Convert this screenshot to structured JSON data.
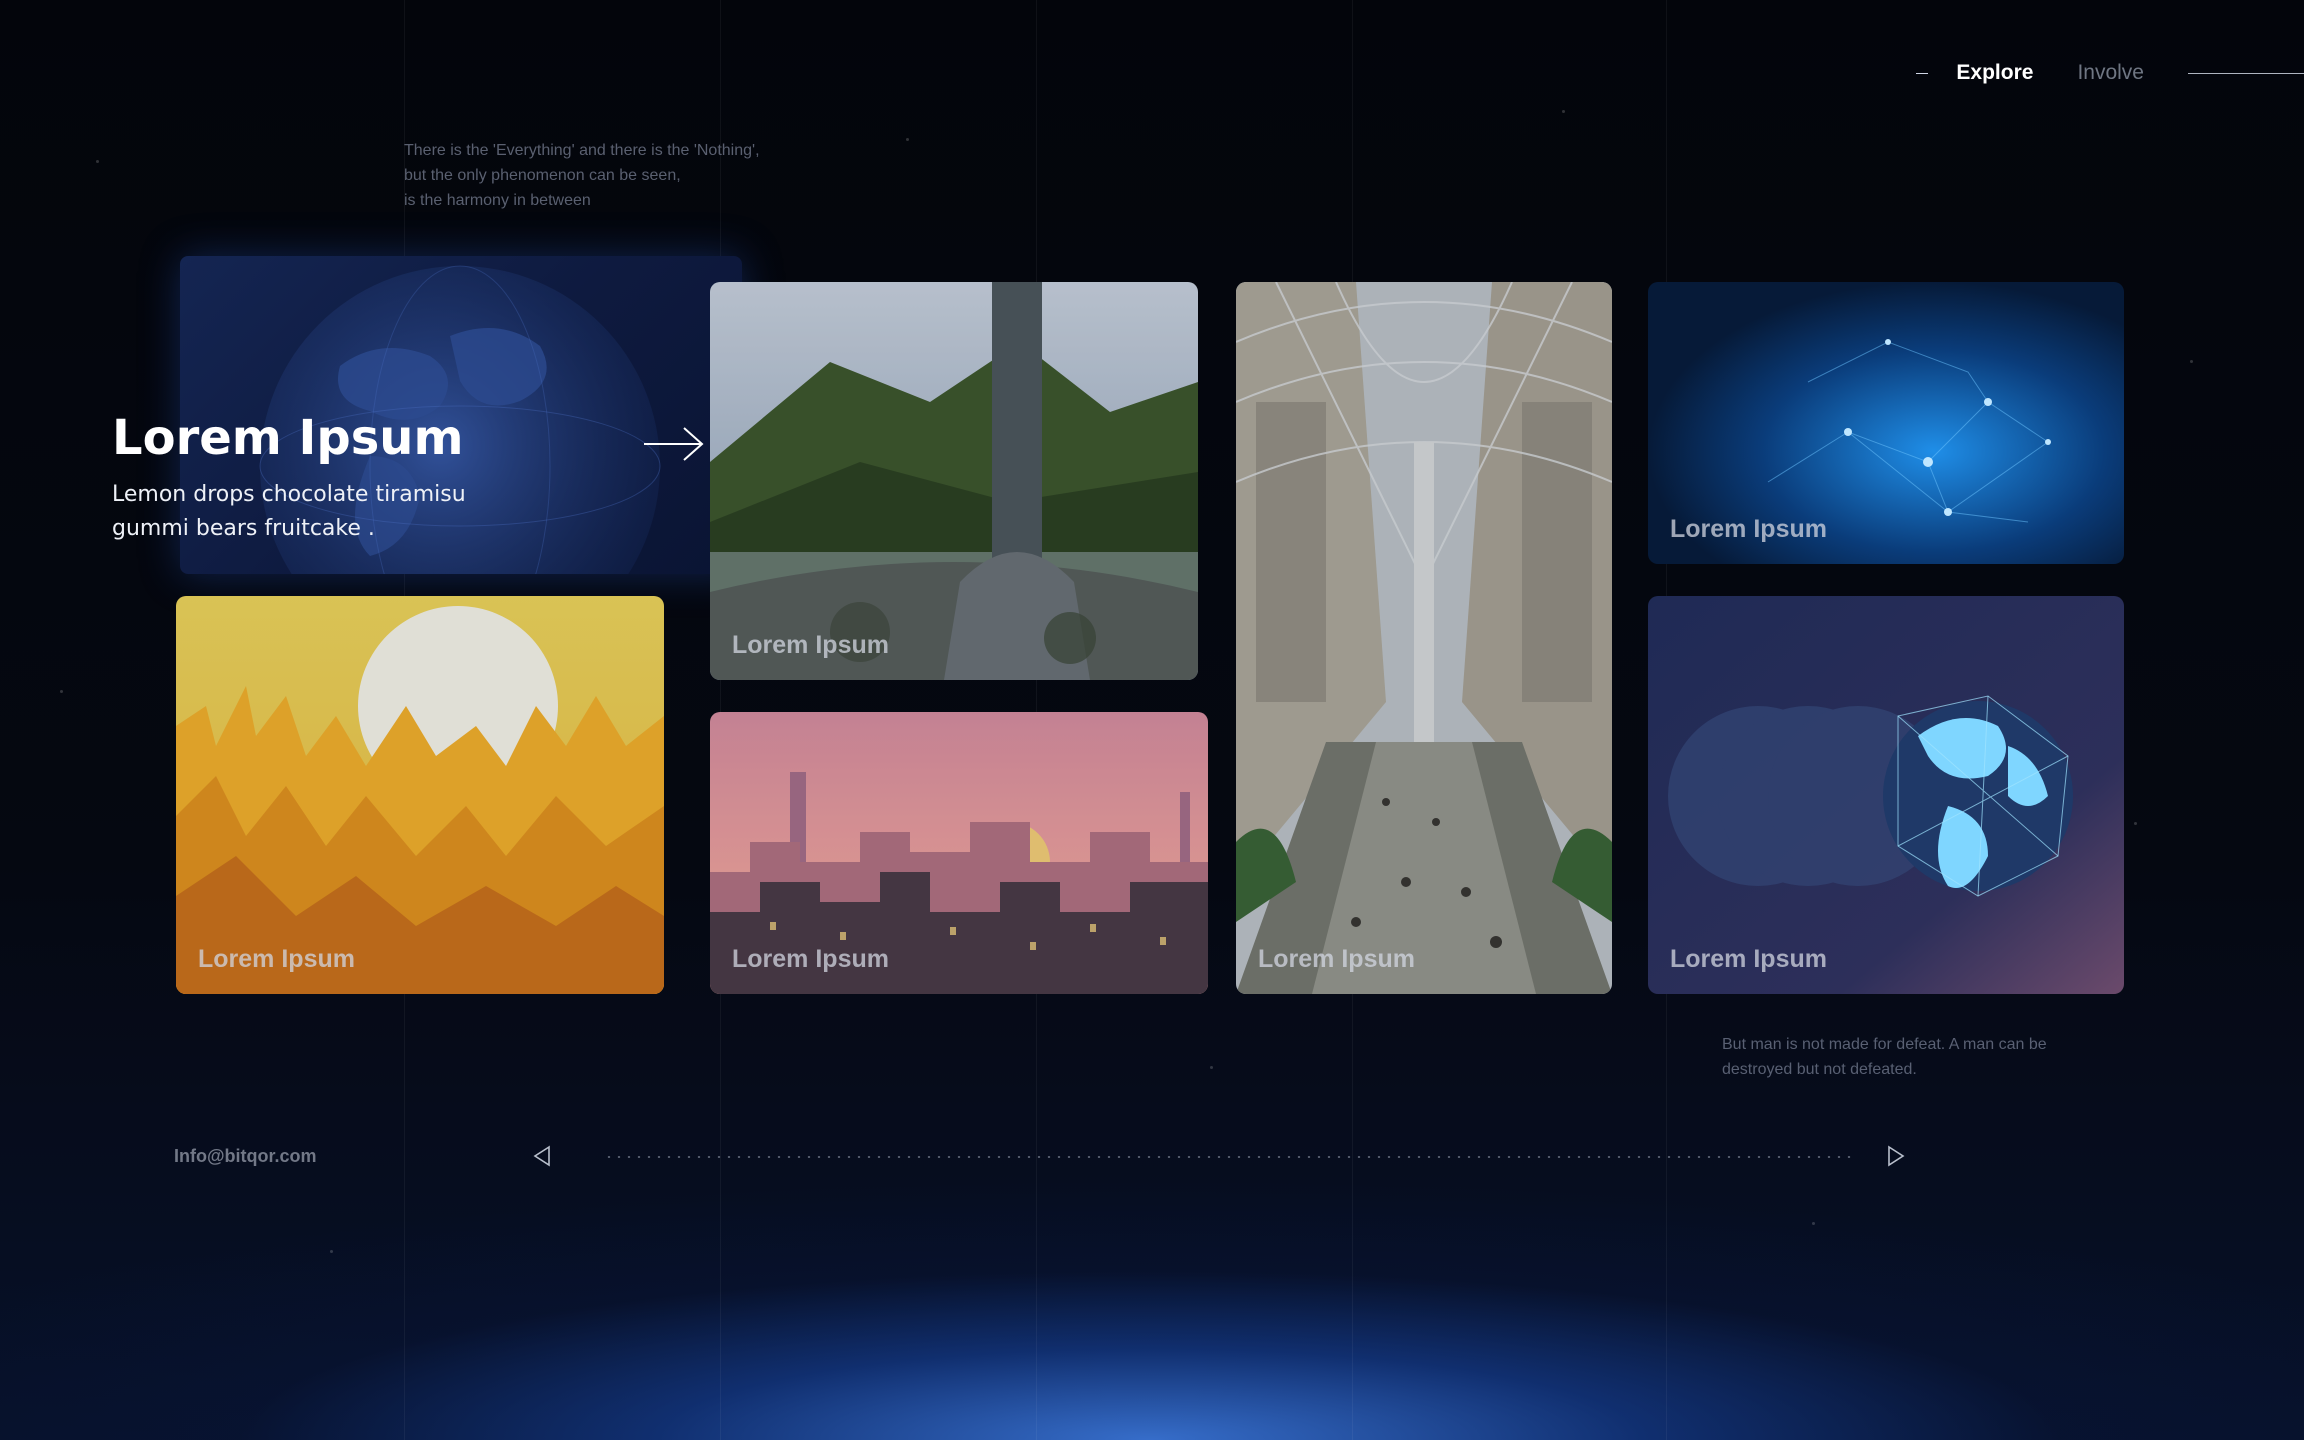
{
  "nav": {
    "items": [
      {
        "label": "Explore",
        "active": true
      },
      {
        "label": "Involve",
        "active": false
      }
    ]
  },
  "quotes": {
    "top_lines": [
      "There is the 'Everything' and there is the 'Nothing',",
      "but the only phenomenon can be seen,",
      "is the harmony in between"
    ],
    "bottom": "But man is not made for defeat. A man can be destroyed but not defeated."
  },
  "hero": {
    "title": "Lorem Ipsum",
    "subtitle": "Lemon drops chocolate tiramisu gummi bears fruitcake ."
  },
  "cards": [
    {
      "label": "Lorem Ipsum",
      "image": "tower-in-mountains"
    },
    {
      "label": "Lorem Ipsum",
      "image": "glass-canopy-atrium"
    },
    {
      "label": "Lorem Ipsum",
      "image": "blue-network-nodes"
    },
    {
      "label": "Lorem Ipsum",
      "image": "golden-city-sun"
    },
    {
      "label": "Lorem Ipsum",
      "image": "pink-sunset-city"
    },
    {
      "label": "Lorem Ipsum",
      "image": "wireframe-globe"
    }
  ],
  "footer": {
    "email": "Info@bitqor.com"
  },
  "icons": [
    "arrow-right-icon",
    "triangle-left-icon",
    "triangle-right-icon"
  ],
  "colors": {
    "background": "#04060d",
    "accent_glow": "#2f6bd6",
    "text_muted": "#6f7683"
  }
}
